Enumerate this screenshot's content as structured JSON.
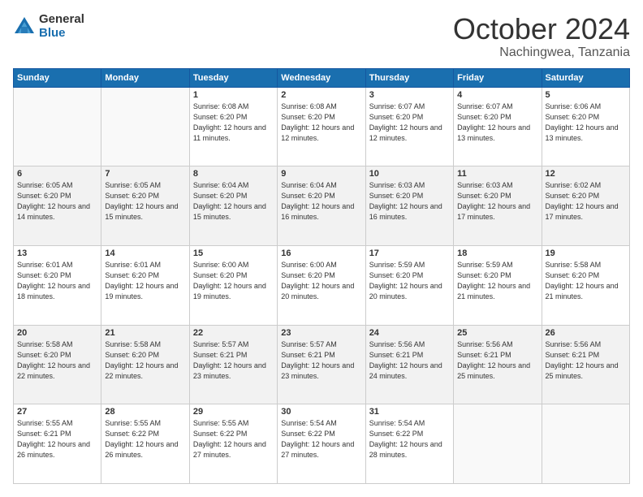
{
  "logo": {
    "general": "General",
    "blue": "Blue"
  },
  "header": {
    "month": "October 2024",
    "location": "Nachingwea, Tanzania"
  },
  "weekdays": [
    "Sunday",
    "Monday",
    "Tuesday",
    "Wednesday",
    "Thursday",
    "Friday",
    "Saturday"
  ],
  "weeks": [
    [
      {
        "day": "",
        "info": ""
      },
      {
        "day": "",
        "info": ""
      },
      {
        "day": "1",
        "info": "Sunrise: 6:08 AM\nSunset: 6:20 PM\nDaylight: 12 hours and 11 minutes."
      },
      {
        "day": "2",
        "info": "Sunrise: 6:08 AM\nSunset: 6:20 PM\nDaylight: 12 hours and 12 minutes."
      },
      {
        "day": "3",
        "info": "Sunrise: 6:07 AM\nSunset: 6:20 PM\nDaylight: 12 hours and 12 minutes."
      },
      {
        "day": "4",
        "info": "Sunrise: 6:07 AM\nSunset: 6:20 PM\nDaylight: 12 hours and 13 minutes."
      },
      {
        "day": "5",
        "info": "Sunrise: 6:06 AM\nSunset: 6:20 PM\nDaylight: 12 hours and 13 minutes."
      }
    ],
    [
      {
        "day": "6",
        "info": "Sunrise: 6:05 AM\nSunset: 6:20 PM\nDaylight: 12 hours and 14 minutes."
      },
      {
        "day": "7",
        "info": "Sunrise: 6:05 AM\nSunset: 6:20 PM\nDaylight: 12 hours and 15 minutes."
      },
      {
        "day": "8",
        "info": "Sunrise: 6:04 AM\nSunset: 6:20 PM\nDaylight: 12 hours and 15 minutes."
      },
      {
        "day": "9",
        "info": "Sunrise: 6:04 AM\nSunset: 6:20 PM\nDaylight: 12 hours and 16 minutes."
      },
      {
        "day": "10",
        "info": "Sunrise: 6:03 AM\nSunset: 6:20 PM\nDaylight: 12 hours and 16 minutes."
      },
      {
        "day": "11",
        "info": "Sunrise: 6:03 AM\nSunset: 6:20 PM\nDaylight: 12 hours and 17 minutes."
      },
      {
        "day": "12",
        "info": "Sunrise: 6:02 AM\nSunset: 6:20 PM\nDaylight: 12 hours and 17 minutes."
      }
    ],
    [
      {
        "day": "13",
        "info": "Sunrise: 6:01 AM\nSunset: 6:20 PM\nDaylight: 12 hours and 18 minutes."
      },
      {
        "day": "14",
        "info": "Sunrise: 6:01 AM\nSunset: 6:20 PM\nDaylight: 12 hours and 19 minutes."
      },
      {
        "day": "15",
        "info": "Sunrise: 6:00 AM\nSunset: 6:20 PM\nDaylight: 12 hours and 19 minutes."
      },
      {
        "day": "16",
        "info": "Sunrise: 6:00 AM\nSunset: 6:20 PM\nDaylight: 12 hours and 20 minutes."
      },
      {
        "day": "17",
        "info": "Sunrise: 5:59 AM\nSunset: 6:20 PM\nDaylight: 12 hours and 20 minutes."
      },
      {
        "day": "18",
        "info": "Sunrise: 5:59 AM\nSunset: 6:20 PM\nDaylight: 12 hours and 21 minutes."
      },
      {
        "day": "19",
        "info": "Sunrise: 5:58 AM\nSunset: 6:20 PM\nDaylight: 12 hours and 21 minutes."
      }
    ],
    [
      {
        "day": "20",
        "info": "Sunrise: 5:58 AM\nSunset: 6:20 PM\nDaylight: 12 hours and 22 minutes."
      },
      {
        "day": "21",
        "info": "Sunrise: 5:58 AM\nSunset: 6:20 PM\nDaylight: 12 hours and 22 minutes."
      },
      {
        "day": "22",
        "info": "Sunrise: 5:57 AM\nSunset: 6:21 PM\nDaylight: 12 hours and 23 minutes."
      },
      {
        "day": "23",
        "info": "Sunrise: 5:57 AM\nSunset: 6:21 PM\nDaylight: 12 hours and 23 minutes."
      },
      {
        "day": "24",
        "info": "Sunrise: 5:56 AM\nSunset: 6:21 PM\nDaylight: 12 hours and 24 minutes."
      },
      {
        "day": "25",
        "info": "Sunrise: 5:56 AM\nSunset: 6:21 PM\nDaylight: 12 hours and 25 minutes."
      },
      {
        "day": "26",
        "info": "Sunrise: 5:56 AM\nSunset: 6:21 PM\nDaylight: 12 hours and 25 minutes."
      }
    ],
    [
      {
        "day": "27",
        "info": "Sunrise: 5:55 AM\nSunset: 6:21 PM\nDaylight: 12 hours and 26 minutes."
      },
      {
        "day": "28",
        "info": "Sunrise: 5:55 AM\nSunset: 6:22 PM\nDaylight: 12 hours and 26 minutes."
      },
      {
        "day": "29",
        "info": "Sunrise: 5:55 AM\nSunset: 6:22 PM\nDaylight: 12 hours and 27 minutes."
      },
      {
        "day": "30",
        "info": "Sunrise: 5:54 AM\nSunset: 6:22 PM\nDaylight: 12 hours and 27 minutes."
      },
      {
        "day": "31",
        "info": "Sunrise: 5:54 AM\nSunset: 6:22 PM\nDaylight: 12 hours and 28 minutes."
      },
      {
        "day": "",
        "info": ""
      },
      {
        "day": "",
        "info": ""
      }
    ]
  ]
}
